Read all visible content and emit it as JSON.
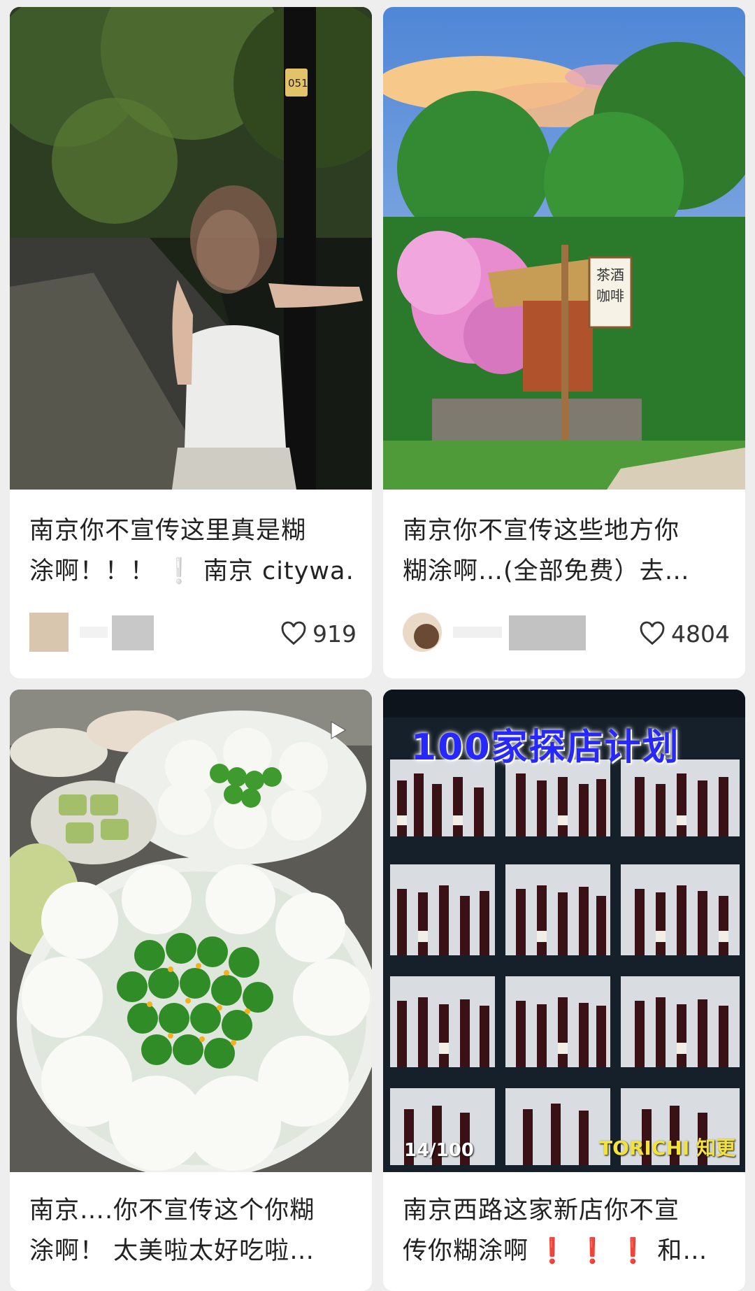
{
  "cards": [
    {
      "title_line1": "南京你不宣传这里真是糊",
      "title_line2": "涂啊！！！  ❕ 南京 citywa…",
      "likes": "919",
      "image": "woman-under-tree-street-photo"
    },
    {
      "title_line1": "南京你不宣传这些地方你",
      "title_line2": "糊涂啊…(全部免费）去…",
      "likes": "4804",
      "image": "tea-house-blossom-scene",
      "sign_text": "茶酒咖啡"
    },
    {
      "title_line1": "南京….你不宣传这个你糊",
      "title_line2": "涂啊！ 太美啦太好吃啦…",
      "image": "osmanthus-dumplings-plate",
      "has_video": true
    },
    {
      "title_line1": "南京西路这家新店你不宣",
      "title_line2_prefix": "传你糊涂啊",
      "title_line2_marks": "❗ ❗ ❗",
      "title_line2_suffix": " 和…",
      "image": "wine-shelves-shop",
      "overlay_title": "100家探店计划",
      "overlay_counter": "14/100",
      "overlay_brand": "TORICHI 知更"
    }
  ],
  "icons": {
    "like": "heart-outline-icon",
    "video": "play-icon"
  },
  "colors": {
    "background": "#eeeeee",
    "card": "#ffffff",
    "title_text": "#222222",
    "exclaim": "#d8101d",
    "overlay_blue": "#2727ff"
  }
}
